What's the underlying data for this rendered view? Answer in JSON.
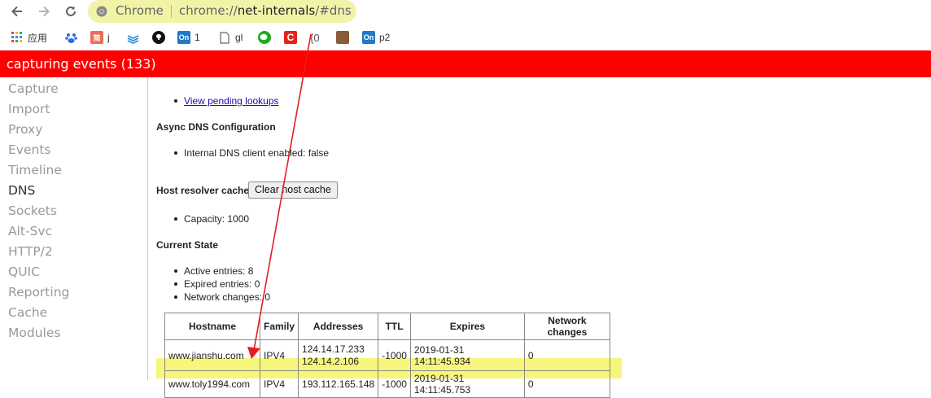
{
  "browser": {
    "chip_label": "Chrome",
    "url_prefix": "chrome://",
    "url_host": "net-internals",
    "url_suffix": "/#dns"
  },
  "bookmarks": [
    {
      "label": "应用",
      "icon": "apps-grid-icon"
    },
    {
      "label": "",
      "icon": "baidu-paw-icon"
    },
    {
      "label": "j",
      "icon": "jianshu-icon"
    },
    {
      "label": "",
      "icon": "layers-icon"
    },
    {
      "label": "",
      "icon": "github-icon"
    },
    {
      "label": "1",
      "icon": "oneNote-icon"
    },
    {
      "label": "gl",
      "icon": "page-icon"
    },
    {
      "label": "",
      "icon": "wechat-icon"
    },
    {
      "label": "",
      "icon": "red-c-icon"
    },
    {
      "label": "{0",
      "icon": "braces-icon"
    },
    {
      "label": "",
      "icon": "avatar-icon"
    },
    {
      "label": "p2",
      "icon": "oneNote-icon"
    }
  ],
  "banner": {
    "text": "capturing events (133)"
  },
  "sidebar": {
    "items": [
      "Capture",
      "Import",
      "Proxy",
      "Events",
      "Timeline",
      "DNS",
      "Sockets",
      "Alt-Svc",
      "HTTP/2",
      "QUIC",
      "Reporting",
      "Cache",
      "Modules"
    ],
    "active": "DNS"
  },
  "content": {
    "pending_link": "View pending lookups",
    "async_heading": "Async DNS Configuration",
    "internal_dns": "Internal DNS client enabled: false",
    "cache_heading": "Host resolver cache",
    "clear_button": "Clear host cache",
    "capacity": "Capacity: 1000",
    "state_heading": "Current State",
    "active_entries": "Active entries: 8",
    "expired_entries": "Expired entries: 0",
    "network_changes": "Network changes: 0"
  },
  "table": {
    "headers": [
      "Hostname",
      "Family",
      "Addresses",
      "TTL",
      "Expires",
      "Network changes"
    ],
    "rows": [
      {
        "hostname": "www.jianshu.com",
        "family": "IPV4",
        "addresses": [
          "124.14.17.233",
          "124.14.2.106"
        ],
        "ttl": "-1000",
        "expires": "2019-01-31 14:11:45.934",
        "changes": "0"
      },
      {
        "hostname": "www.toly1994.com",
        "family": "IPV4",
        "addresses": [
          "193.112.165.148"
        ],
        "ttl": "-1000",
        "expires": "2019-01-31 14:11:45.753",
        "changes": "0"
      }
    ]
  },
  "colors": {
    "banner": "#ff0000",
    "highlight": "#f6f67c",
    "arrow": "#e02020",
    "link": "#1a0dab"
  }
}
